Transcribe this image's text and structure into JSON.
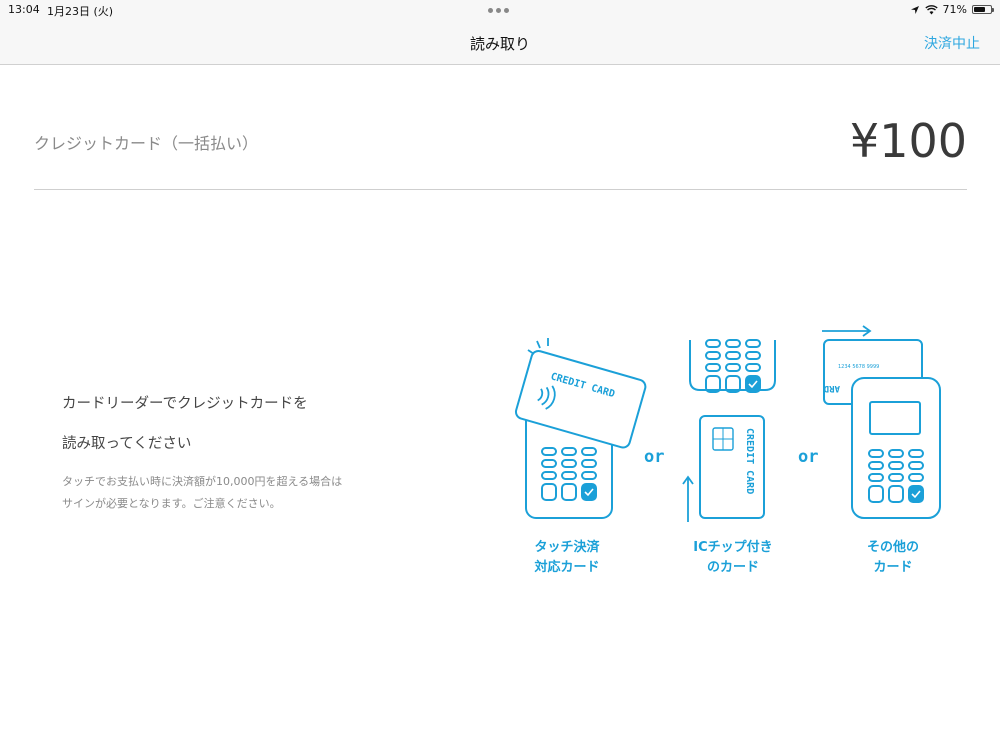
{
  "status_bar": {
    "time": "13:04",
    "date": "1月23日 (火)",
    "battery": "71%",
    "battery_level": 0.71
  },
  "nav": {
    "title": "読み取り",
    "cancel_label": "決済中止"
  },
  "payment": {
    "method": "クレジットカード（一括払い）",
    "amount": "¥100"
  },
  "instruction": {
    "line1": "カードリーダーでクレジットカードを",
    "line2": "読み取ってください"
  },
  "note": {
    "line1": "タッチでお支払い時に決済額が10,000円を超える場合は",
    "line2": "サインが必要となります。ご注意ください。"
  },
  "illustration": {
    "card_text": "CREDIT CARD",
    "card_text_partial": "ARD",
    "card_number": "1234 5678 9999",
    "or_label": "or",
    "captions": {
      "touch_line1": "タッチ決済",
      "touch_line2": "対応カード",
      "chip_line1": "ICチップ付き",
      "chip_line2": "のカード",
      "other_line1": "その他の",
      "other_line2": "カード"
    }
  },
  "colors": {
    "accent": "#2ea7e0",
    "illustration": "#1ba0d8"
  }
}
